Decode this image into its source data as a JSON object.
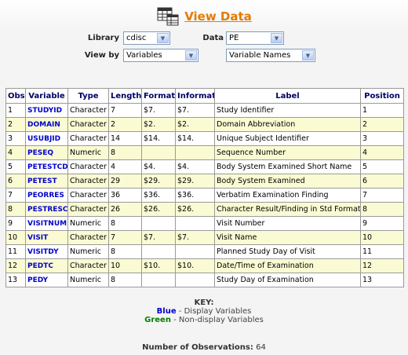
{
  "header": {
    "title": "View Data",
    "icon": "view-data-icon"
  },
  "controls": {
    "library_label": "Library",
    "library_value": "cdisc",
    "data_label": "Data",
    "data_value": "PE",
    "viewby_label": "View by",
    "viewby_value": "Variables",
    "names_value": "Variable Names"
  },
  "table": {
    "headers": [
      "Obs",
      "Variable",
      "Type",
      "Length",
      "Format",
      "Informat",
      "Label",
      "Position"
    ],
    "rows": [
      [
        "1",
        "STUDYID",
        "Character",
        "7",
        "$7.",
        "$7.",
        "Study Identifier",
        "1"
      ],
      [
        "2",
        "DOMAIN",
        "Character",
        "2",
        "$2.",
        "$2.",
        "Domain Abbreviation",
        "2"
      ],
      [
        "3",
        "USUBJID",
        "Character",
        "14",
        "$14.",
        "$14.",
        "Unique Subject Identifier",
        "3"
      ],
      [
        "4",
        "PESEQ",
        "Numeric",
        "8",
        "",
        "",
        "Sequence Number",
        "4"
      ],
      [
        "5",
        "PETESTCD",
        "Character",
        "4",
        "$4.",
        "$4.",
        "Body System Examined Short Name",
        "5"
      ],
      [
        "6",
        "PETEST",
        "Character",
        "29",
        "$29.",
        "$29.",
        "Body System Examined",
        "6"
      ],
      [
        "7",
        "PEORRES",
        "Character",
        "36",
        "$36.",
        "$36.",
        "Verbatim Examination Finding",
        "7"
      ],
      [
        "8",
        "PESTRESC",
        "Character",
        "26",
        "$26.",
        "$26.",
        "Character Result/Finding in Std Format",
        "8"
      ],
      [
        "9",
        "VISITNUM",
        "Numeric",
        "8",
        "",
        "",
        "Visit Number",
        "9"
      ],
      [
        "10",
        "VISIT",
        "Character",
        "7",
        "$7.",
        "$7.",
        "Visit Name",
        "10"
      ],
      [
        "11",
        "VISITDY",
        "Numeric",
        "8",
        "",
        "",
        "Planned Study Day of Visit",
        "11"
      ],
      [
        "12",
        "PEDTC",
        "Character",
        "10",
        "$10.",
        "$10.",
        "Date/Time of Examination",
        "12"
      ],
      [
        "13",
        "PEDY",
        "Numeric",
        "8",
        "",
        "",
        "Study Day of Examination",
        "13"
      ]
    ]
  },
  "key": {
    "title": "KEY:",
    "blue_word": "Blue",
    "blue_desc": " - Display Variables",
    "green_word": "Green",
    "green_desc": " - Non-display Variables"
  },
  "footer": {
    "obs_label": "Number of Observations:",
    "obs_value": "64"
  },
  "colors": {
    "title": "#e37b00",
    "blue": "#0000cc",
    "green": "#008000",
    "row_alt": "#fbfbd3"
  }
}
